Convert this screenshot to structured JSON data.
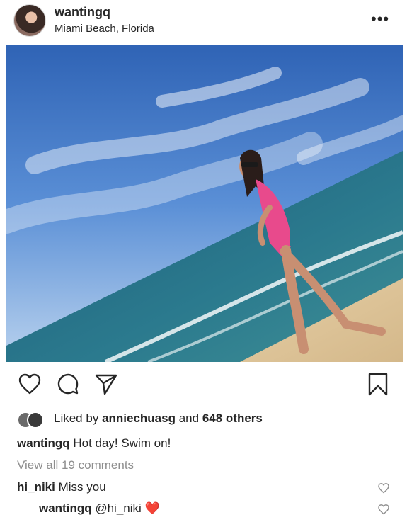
{
  "header": {
    "username": "wantingq",
    "location": "Miami Beach, Florida",
    "more_icon": "more-horizontal-icon"
  },
  "actions": {
    "icons": [
      "heart-icon",
      "comment-icon",
      "share-icon",
      "bookmark-icon"
    ]
  },
  "likes": {
    "prefix": "Liked by",
    "user": "anniechuasg",
    "middle": "and",
    "others": "648 others"
  },
  "caption": {
    "username": "wantingq",
    "text": "Hot day! Swim on!"
  },
  "view_all": "View all 19 comments",
  "comments": [
    {
      "username": "hi_niki",
      "text": "Miss you"
    },
    {
      "username": "wantingq",
      "text": "@hi_niki",
      "emoji": "❤️"
    }
  ],
  "colors": {
    "text": "#262626",
    "muted": "#8e8e8e",
    "heart_emoji": "#e0143c"
  }
}
